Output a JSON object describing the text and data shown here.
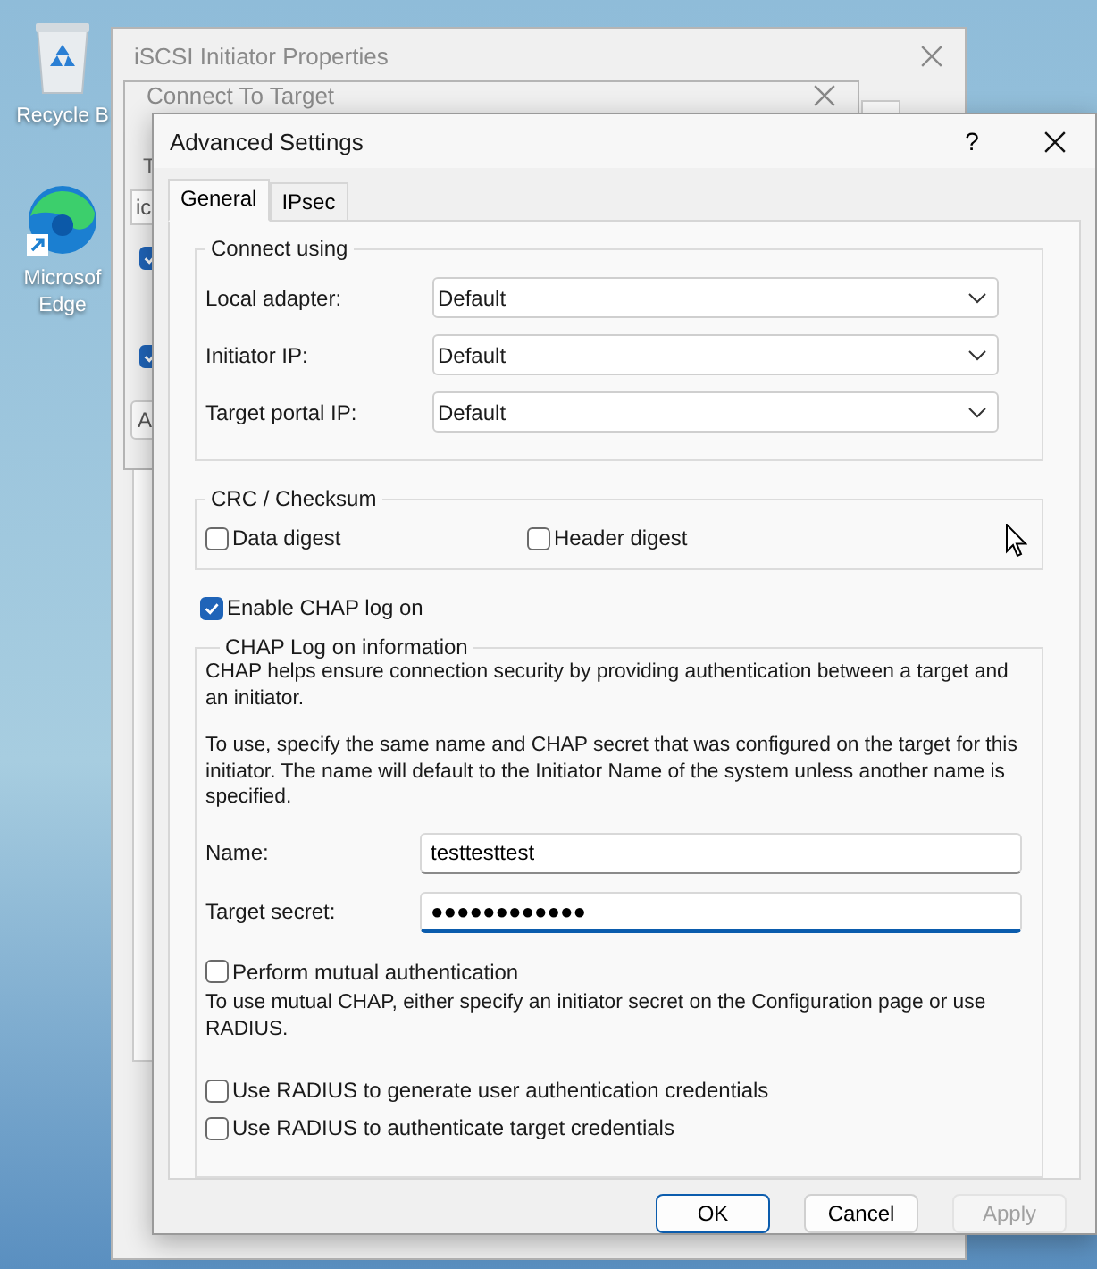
{
  "desktop_icons": [
    {
      "kind": "recycle",
      "label": "Recycle B"
    },
    {
      "kind": "edge",
      "label": "Microsof\nEdge"
    }
  ],
  "main_window": {
    "title": "iSCSI Initiator Properties"
  },
  "connect_window": {
    "title": "Connect To Target",
    "label": "T",
    "field_value": "ic",
    "checkboxes": [
      {
        "checked": true
      },
      {
        "checked": true
      }
    ],
    "button": "A"
  },
  "dialog": {
    "title": "Advanced Settings",
    "help": "?",
    "tabs": [
      {
        "label": "General",
        "selected": true
      },
      {
        "label": "IPsec",
        "selected": false
      }
    ],
    "connect_using": {
      "title": "Connect using",
      "rows": [
        {
          "label": "Local adapter:",
          "value": "Default"
        },
        {
          "label": "Initiator IP:",
          "value": "Default"
        },
        {
          "label": "Target portal IP:",
          "value": "Default"
        }
      ]
    },
    "crc": {
      "title": "CRC / Checksum",
      "options": [
        {
          "label": "Data digest",
          "checked": false
        },
        {
          "label": "Header digest",
          "checked": false
        }
      ]
    },
    "enable_chap": {
      "label": "Enable CHAP log on",
      "checked": true
    },
    "chap": {
      "title": "CHAP Log on information",
      "paragraphs": [
        "CHAP helps ensure connection security by providing authentication between a target and\nan initiator.",
        "To use, specify the same name and CHAP secret that was configured on the target for this\ninitiator.  The name will default to the Initiator Name of the system unless another name is\nspecified."
      ],
      "fields": [
        {
          "label": "Name:",
          "value": "testtesttest",
          "focused": false
        },
        {
          "label": "Target secret:",
          "value": "●●●●●●●●●●●●",
          "focused": true
        }
      ],
      "mutual": {
        "label": "Perform mutual authentication",
        "checked": false
      },
      "mutual_note": "To use mutual CHAP, either specify an initiator secret on the Configuration page or use\nRADIUS.",
      "radius_options": [
        {
          "label": "Use RADIUS to generate user authentication credentials",
          "checked": false
        },
        {
          "label": "Use RADIUS to authenticate target credentials",
          "checked": false
        }
      ]
    },
    "buttons": [
      {
        "label": "OK",
        "default": true,
        "disabled": false
      },
      {
        "label": "Cancel",
        "default": false,
        "disabled": false
      },
      {
        "label": "Apply",
        "default": false,
        "disabled": true
      }
    ]
  }
}
